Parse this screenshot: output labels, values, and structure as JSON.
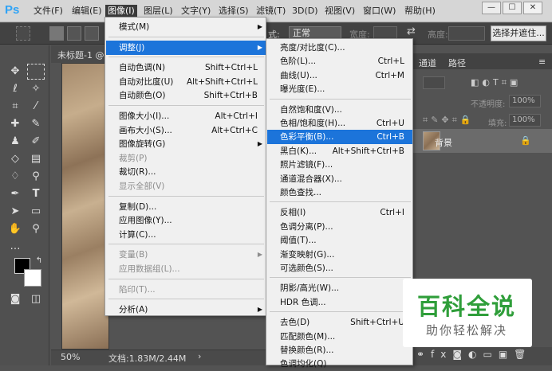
{
  "app": {
    "logo": "Ps"
  },
  "menubar": {
    "items": [
      "文件(F)",
      "编辑(E)",
      "图像(I)",
      "图层(L)",
      "文字(Y)",
      "选择(S)",
      "滤镜(T)",
      "3D(D)",
      "视图(V)",
      "窗口(W)",
      "帮助(H)"
    ],
    "active": "图像(I)"
  },
  "window_controls": {
    "minimize": "—",
    "maximize": "☐",
    "close": "✕"
  },
  "options_bar": {
    "style_label": "式:",
    "style_value": "正常",
    "width_label": "宽度:",
    "height_label": "高度:",
    "select_mask_button": "选择并遮住..."
  },
  "document": {
    "tab_title": "未标题-1 @",
    "zoom": "50%",
    "doc_info": "文档:1.83M/2.44M",
    "status_arrow": "›"
  },
  "panels": {
    "tabs": [
      "通道",
      "路径"
    ],
    "opacity_label": "不透明度:",
    "opacity_value": "100%",
    "fill_label": "填充:",
    "fill_value": "100%",
    "layer_name": "背景"
  },
  "image_menu": [
    {
      "label": "模式(M)",
      "submenu": true
    },
    {
      "separator": true
    },
    {
      "label": "调整(J)",
      "submenu": true,
      "highlighted": true
    },
    {
      "separator": true
    },
    {
      "label": "自动色调(N)",
      "shortcut": "Shift+Ctrl+L"
    },
    {
      "label": "自动对比度(U)",
      "shortcut": "Alt+Shift+Ctrl+L"
    },
    {
      "label": "自动颜色(O)",
      "shortcut": "Shift+Ctrl+B"
    },
    {
      "separator": true
    },
    {
      "label": "图像大小(I)...",
      "shortcut": "Alt+Ctrl+I"
    },
    {
      "label": "画布大小(S)...",
      "shortcut": "Alt+Ctrl+C"
    },
    {
      "label": "图像旋转(G)",
      "submenu": true
    },
    {
      "label": "裁剪(P)",
      "disabled": true
    },
    {
      "label": "裁切(R)..."
    },
    {
      "label": "显示全部(V)",
      "disabled": true
    },
    {
      "separator": true
    },
    {
      "label": "复制(D)..."
    },
    {
      "label": "应用图像(Y)..."
    },
    {
      "label": "计算(C)..."
    },
    {
      "separator": true
    },
    {
      "label": "变量(B)",
      "submenu": true,
      "disabled": true
    },
    {
      "label": "应用数据组(L)...",
      "disabled": true
    },
    {
      "separator": true
    },
    {
      "label": "陷印(T)...",
      "disabled": true
    },
    {
      "separator": true
    },
    {
      "label": "分析(A)",
      "submenu": true
    }
  ],
  "adjust_menu": [
    {
      "label": "亮度/对比度(C)..."
    },
    {
      "label": "色阶(L)...",
      "shortcut": "Ctrl+L"
    },
    {
      "label": "曲线(U)...",
      "shortcut": "Ctrl+M"
    },
    {
      "label": "曝光度(E)..."
    },
    {
      "separator": true
    },
    {
      "label": "自然饱和度(V)..."
    },
    {
      "label": "色相/饱和度(H)...",
      "shortcut": "Ctrl+U"
    },
    {
      "label": "色彩平衡(B)...",
      "shortcut": "Ctrl+B",
      "highlighted": true
    },
    {
      "label": "黑白(K)...",
      "shortcut": "Alt+Shift+Ctrl+B"
    },
    {
      "label": "照片滤镜(F)..."
    },
    {
      "label": "通道混合器(X)..."
    },
    {
      "label": "颜色查找..."
    },
    {
      "separator": true
    },
    {
      "label": "反相(I)",
      "shortcut": "Ctrl+I"
    },
    {
      "label": "色调分离(P)..."
    },
    {
      "label": "阈值(T)..."
    },
    {
      "label": "渐变映射(G)..."
    },
    {
      "label": "可选颜色(S)..."
    },
    {
      "separator": true
    },
    {
      "label": "阴影/高光(W)..."
    },
    {
      "label": "HDR 色调..."
    },
    {
      "separator": true
    },
    {
      "label": "去色(D)",
      "shortcut": "Shift+Ctrl+U"
    },
    {
      "label": "匹配颜色(M)..."
    },
    {
      "label": "替换颜色(R)..."
    },
    {
      "label": "色调均化(Q)"
    }
  ],
  "watermark": {
    "title": "百科全说",
    "subtitle": "助你轻松解决"
  },
  "colors": {
    "highlight": "#1c74da",
    "menu_bg": "#f0f0f0",
    "watermark_green": "#2f9e3a"
  }
}
